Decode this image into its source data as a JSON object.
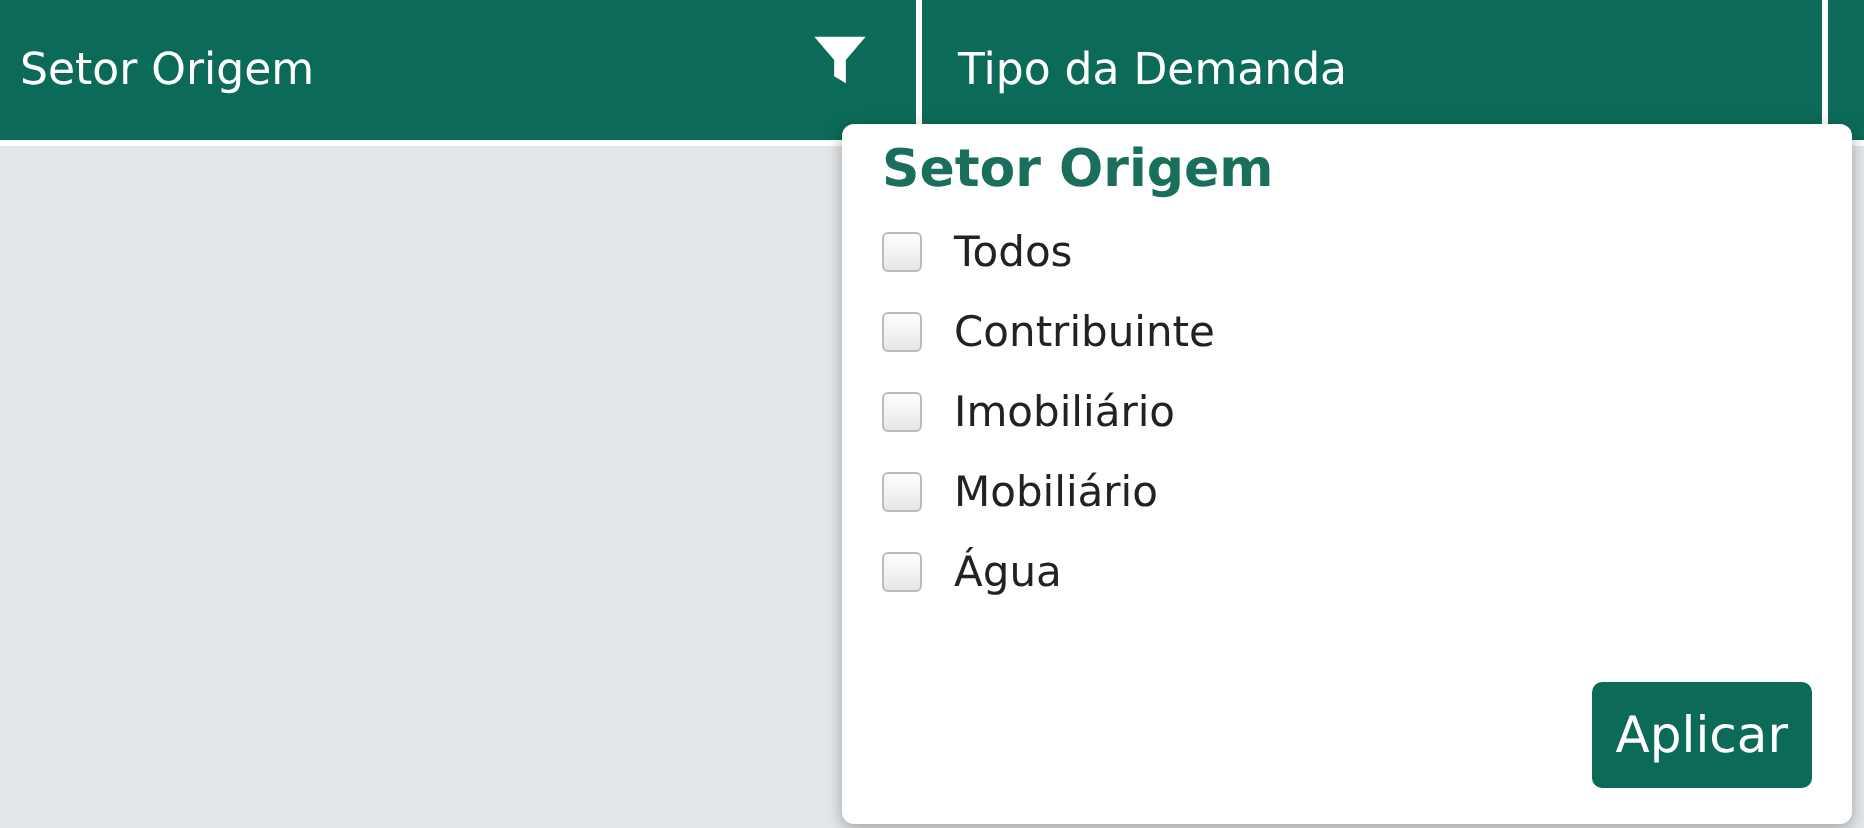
{
  "table": {
    "columns": [
      {
        "label": "Setor Origem",
        "filter": true
      },
      {
        "label": "Tipo da Demanda",
        "filter": false
      }
    ]
  },
  "filter_popup": {
    "title": "Setor Origem",
    "options": [
      {
        "label": "Todos",
        "checked": false
      },
      {
        "label": "Contribuinte",
        "checked": false
      },
      {
        "label": "Imobiliário",
        "checked": false
      },
      {
        "label": "Mobiliário",
        "checked": false
      },
      {
        "label": "Água",
        "checked": false
      }
    ],
    "button": "Aplicar"
  }
}
